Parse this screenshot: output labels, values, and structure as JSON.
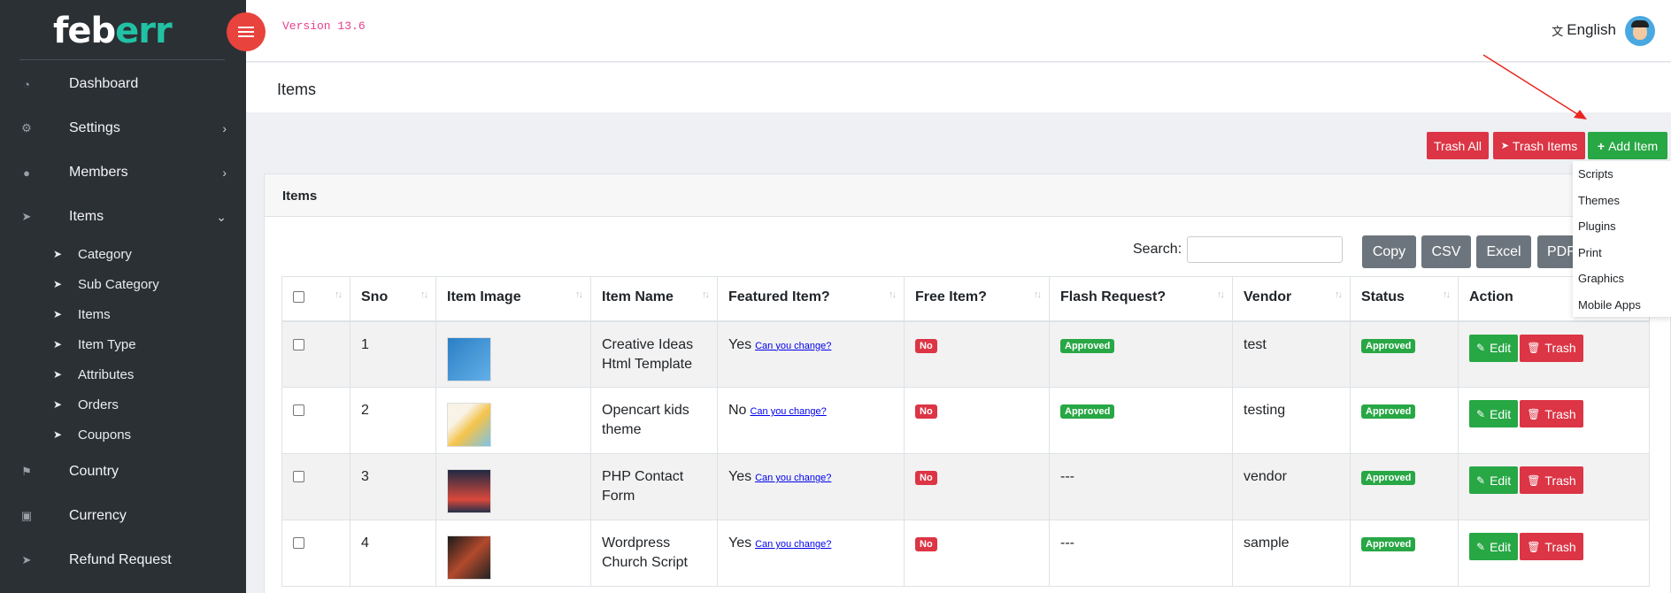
{
  "colors": {
    "sidebar_bg": "#2b3035",
    "brand_accent": "#21c1a4",
    "danger": "#dc3545",
    "success": "#28a745",
    "secondary": "#6c757d",
    "version_text": "#e83e8c"
  },
  "brand": {
    "main": "feb",
    "accent": "err"
  },
  "topbar": {
    "version": "Version 13.6",
    "language": "English"
  },
  "sidebar": {
    "items": [
      {
        "label": "Dashboard",
        "icon": "dashboard-icon"
      },
      {
        "label": "Settings",
        "icon": "gears-icon",
        "chevron": "right"
      },
      {
        "label": "Members",
        "icon": "users-icon",
        "chevron": "right"
      },
      {
        "label": "Items",
        "icon": "paper-plane-icon",
        "chevron": "down"
      }
    ],
    "subitems": [
      "Category",
      "Sub Category",
      "Items",
      "Item Type",
      "Attributes",
      "Orders",
      "Coupons"
    ],
    "bottom": [
      {
        "label": "Country",
        "icon": "flag-icon"
      },
      {
        "label": "Currency",
        "icon": "money-icon"
      },
      {
        "label": "Refund Request",
        "icon": "send-icon"
      }
    ]
  },
  "page": {
    "title": "Items"
  },
  "actions": {
    "trash_all": "Trash All",
    "trash_items": "Trash Items",
    "add_item": "Add Item"
  },
  "add_menu": [
    "Scripts",
    "Themes",
    "Plugins",
    "Print",
    "Graphics",
    "Mobile Apps"
  ],
  "card": {
    "title": "Items"
  },
  "search": {
    "label": "Search:"
  },
  "exports": {
    "copy": "Copy",
    "csv": "CSV",
    "excel": "Excel",
    "pdf": "PDF"
  },
  "table": {
    "headers": [
      "Sno",
      "Item Image",
      "Item Name",
      "Featured Item?",
      "Free Item?",
      "Flash Request?",
      "Vendor",
      "Status",
      "Action"
    ],
    "change_link": "Can you change?",
    "edit_label": "Edit",
    "trash_label": "Trash",
    "rows": [
      {
        "sno": "1",
        "name_line1": "Creative Ideas",
        "name_line2": "Html Template",
        "featured": "Yes",
        "free": "No",
        "flash": "Approved",
        "vendor": "test",
        "status": "Approved"
      },
      {
        "sno": "2",
        "name_line1": "Opencart kids",
        "name_line2": "theme",
        "featured": "No",
        "free": "No",
        "flash": "Approved",
        "vendor": "testing",
        "status": "Approved"
      },
      {
        "sno": "3",
        "name_line1": "PHP Contact",
        "name_line2": "Form",
        "featured": "Yes",
        "free": "No",
        "flash": "---",
        "vendor": "vendor",
        "status": "Approved"
      },
      {
        "sno": "4",
        "name_line1": "Wordpress",
        "name_line2": "Church Script",
        "featured": "Yes",
        "free": "No",
        "flash": "---",
        "vendor": "sample",
        "status": "Approved"
      }
    ]
  }
}
